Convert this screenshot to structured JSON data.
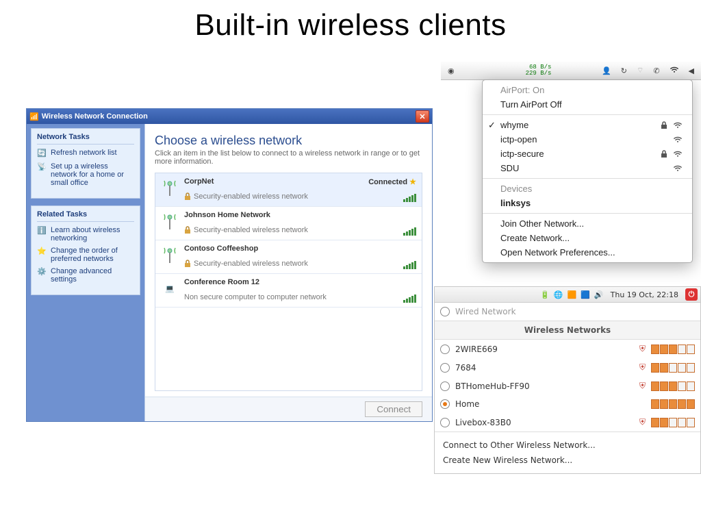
{
  "title": "Built-in wireless clients",
  "xp": {
    "window_title": "Wireless Network Connection",
    "heading": "Choose a wireless network",
    "subheading": "Click an item in the list below to connect to a wireless network in range or to get more information.",
    "connect_btn": "Connect",
    "side": {
      "tasks_h": "Network Tasks",
      "refresh": "Refresh network list",
      "setup": "Set up a wireless network for a home or small office",
      "related_h": "Related Tasks",
      "learn": "Learn about wireless networking",
      "order": "Change the order of preferred networks",
      "advanced": "Change advanced settings"
    },
    "nets": [
      {
        "name": "CorpNet",
        "status": "Connected",
        "desc": "Security-enabled wireless network",
        "secure": true,
        "adhoc": false,
        "selected": true,
        "star": true
      },
      {
        "name": "Johnson Home Network",
        "status": "",
        "desc": "Security-enabled wireless network",
        "secure": true,
        "adhoc": false
      },
      {
        "name": "Contoso Coffeeshop",
        "status": "",
        "desc": "Security-enabled wireless network",
        "secure": true,
        "adhoc": false
      },
      {
        "name": "Conference Room 12",
        "status": "",
        "desc": "Non secure computer to computer network",
        "secure": false,
        "adhoc": true
      }
    ]
  },
  "mac": {
    "stats_up": "68 B/s",
    "stats_down": "229 B/s",
    "status": "AirPort: On",
    "toggle": "Turn AirPort Off",
    "devices_h": "Devices",
    "device": "linksys",
    "join": "Join Other Network...",
    "create": "Create Network...",
    "prefs": "Open Network Preferences...",
    "nets": [
      {
        "name": "whyme",
        "locked": true,
        "connected": true
      },
      {
        "name": "ictp-open",
        "locked": false
      },
      {
        "name": "ictp-secure",
        "locked": true
      },
      {
        "name": "SDU",
        "locked": false
      }
    ]
  },
  "linux": {
    "time": "Thu 19 Oct, 22:18",
    "wired": "Wired Network",
    "header": "Wireless Networks",
    "connect_other": "Connect to Other Wireless Network...",
    "create_new": "Create New Wireless Network...",
    "nets": [
      {
        "name": "2WIRE669",
        "secure": true,
        "bars": 3,
        "sel": false
      },
      {
        "name": "7684",
        "secure": true,
        "bars": 2,
        "sel": false
      },
      {
        "name": "BTHomeHub-FF90",
        "secure": true,
        "bars": 3,
        "sel": false
      },
      {
        "name": "Home",
        "secure": false,
        "bars": 5,
        "sel": true
      },
      {
        "name": "Livebox-83B0",
        "secure": true,
        "bars": 2,
        "sel": false
      }
    ]
  }
}
